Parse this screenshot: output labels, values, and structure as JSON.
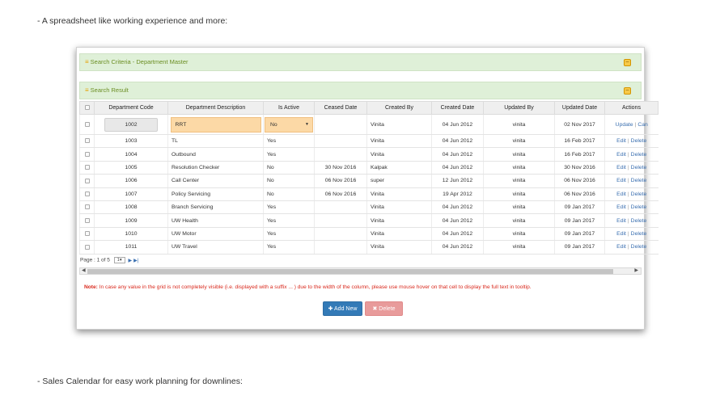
{
  "intro_text": "-  A spreadsheet like working experience and more:",
  "outro_text": "- Sales Calendar for easy work planning for downlines:",
  "search_panel": {
    "title": "Search Criteria - Department Master"
  },
  "result_panel": {
    "title": "Search Result"
  },
  "columns": [
    "Department Code",
    "Department Description",
    "Is Active",
    "Ceased Date",
    "Created By",
    "Created Date",
    "Updated By",
    "Updated Date",
    "Actions"
  ],
  "edit_row": {
    "code": "1002",
    "description": "RRT",
    "is_active": "No",
    "ceased_date": "",
    "created_by": "Vinita",
    "created_date": "04 Jun 2012",
    "updated_by": "vinita",
    "updated_date": "02 Nov 2017",
    "update_label": "Update",
    "cancel_label": "Can"
  },
  "rows": [
    {
      "code": "1003",
      "description": "TL",
      "is_active": "Yes",
      "ceased_date": "",
      "created_by": "Vinita",
      "created_date": "04 Jun 2012",
      "updated_by": "vinita",
      "updated_date": "16 Feb 2017"
    },
    {
      "code": "1004",
      "description": "Outbound",
      "is_active": "Yes",
      "ceased_date": "",
      "created_by": "Vinita",
      "created_date": "04 Jun 2012",
      "updated_by": "vinita",
      "updated_date": "16 Feb 2017"
    },
    {
      "code": "1005",
      "description": "Resolution Checker",
      "is_active": "No",
      "ceased_date": "30 Nov 2016",
      "created_by": "Kalpak",
      "created_date": "04 Jun 2012",
      "updated_by": "vinita",
      "updated_date": "30 Nov 2016"
    },
    {
      "code": "1006",
      "description": "Call Center",
      "is_active": "No",
      "ceased_date": "06 Nov 2016",
      "created_by": "super",
      "created_date": "12 Jun 2012",
      "updated_by": "vinita",
      "updated_date": "06 Nov 2016"
    },
    {
      "code": "1007",
      "description": "Policy Servicing",
      "is_active": "No",
      "ceased_date": "06 Nov 2016",
      "created_by": "Vinita",
      "created_date": "19 Apr 2012",
      "updated_by": "vinita",
      "updated_date": "06 Nov 2016"
    },
    {
      "code": "1008",
      "description": "Branch Servicing",
      "is_active": "Yes",
      "ceased_date": "",
      "created_by": "Vinita",
      "created_date": "04 Jun 2012",
      "updated_by": "vinita",
      "updated_date": "09 Jan 2017"
    },
    {
      "code": "1009",
      "description": "UW Health",
      "is_active": "Yes",
      "ceased_date": "",
      "created_by": "Vinita",
      "created_date": "04 Jun 2012",
      "updated_by": "vinita",
      "updated_date": "09 Jan 2017"
    },
    {
      "code": "1010",
      "description": "UW Motor",
      "is_active": "Yes",
      "ceased_date": "",
      "created_by": "Vinita",
      "created_date": "04 Jun 2012",
      "updated_by": "vinita",
      "updated_date": "09 Jan 2017"
    },
    {
      "code": "1011",
      "description": "UW Travel",
      "is_active": "Yes",
      "ceased_date": "",
      "created_by": "Vinita",
      "created_date": "04 Jun 2012",
      "updated_by": "vinita",
      "updated_date": "09 Jan 2017"
    }
  ],
  "row_actions": {
    "edit": "Edit",
    "delete": "Delete"
  },
  "pager": {
    "label": "Page : 1 of 5",
    "page": "1"
  },
  "note": {
    "prefix": "Note:",
    "text": " In case any value in the grid is not completely visible (i.e. displayed with a suffix ... ) due to the width of the column, please use mouse hover on that cell to display the full text in tooltip."
  },
  "buttons": {
    "add": "Add New",
    "delete": "Delete"
  },
  "colors": {
    "panel_bg": "#dff0d8",
    "panel_text": "#6b8e23",
    "add_button": "#337ab7",
    "delete_button": "#e89b9b",
    "note": "#d9281c"
  }
}
